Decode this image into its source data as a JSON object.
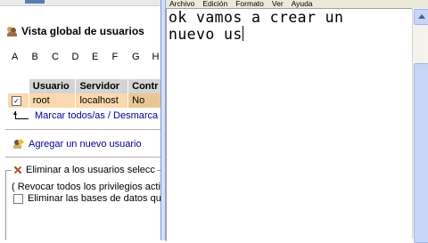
{
  "left_pane": {
    "title": "Vista global de usuarios",
    "letters": [
      "A",
      "B",
      "C",
      "D",
      "E",
      "F",
      "G",
      "H"
    ],
    "table": {
      "headers": [
        "Usuario",
        "Servidor",
        "Contr"
      ],
      "rows": [
        {
          "checked": "✓",
          "usuario": "root",
          "servidor": "localhost",
          "contr": "No"
        }
      ]
    },
    "mark_link": "Marcar todos/as / Desmarca",
    "add_user_link": "Agregar un nuevo usuario",
    "delete_legend": "Eliminar a los usuarios selecc",
    "revoke_option": "( Revocar todos los privilegios activ",
    "drop_db_option": "Eliminar las bases de datos qu"
  },
  "notepad": {
    "menu": [
      "Archivo",
      "Edición",
      "Formato",
      "Ver",
      "Ayuda"
    ],
    "lines": [
      "ok vamos a crear un",
      "nuevo us"
    ]
  },
  "colors": {
    "selected_row": "#fcd9ad",
    "header_bg": "#d4d4d4",
    "link": "#0000a0",
    "menubar": "#ece9d8",
    "scrollbar_thumb": "#c7d6f8"
  }
}
